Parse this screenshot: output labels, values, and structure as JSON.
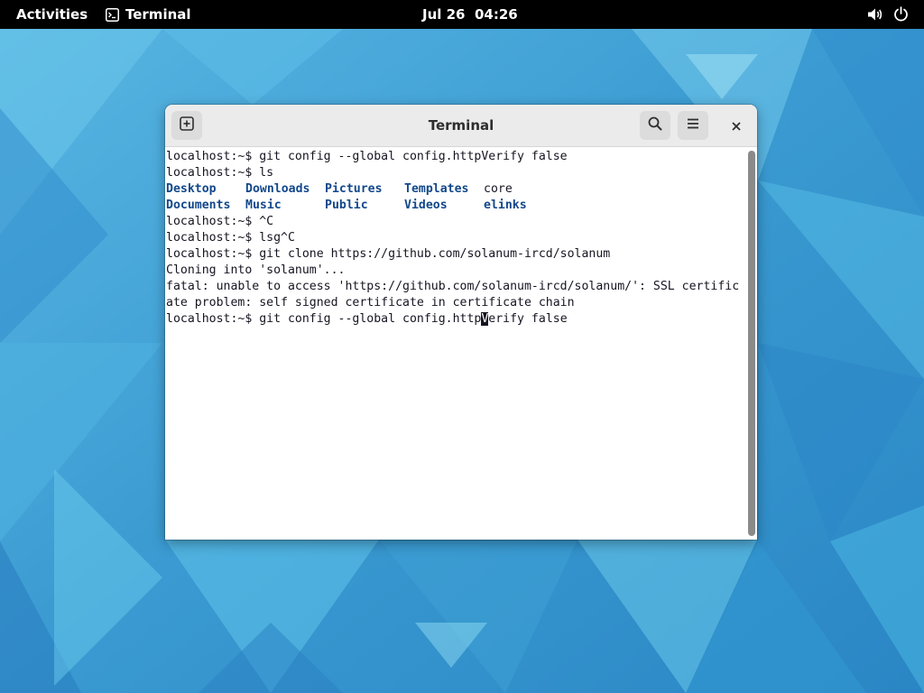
{
  "topbar": {
    "activities_label": "Activities",
    "app_name": "Terminal",
    "app_icon": "terminal-icon",
    "clock": "Jul 26  04:26",
    "status_icons": [
      "volume-icon",
      "power-icon"
    ]
  },
  "window": {
    "title": "Terminal",
    "buttons": [
      "new-tab-icon",
      "search-icon",
      "hamburger-menu-icon",
      "close-icon"
    ]
  },
  "terminal": {
    "lines": [
      "localhost:~$ git config --global config.httpVerify false",
      "localhost:~$ ls"
    ],
    "ls_output": [
      [
        "Desktop",
        "Downloads",
        "Pictures",
        "Templates",
        "core"
      ],
      [
        "Documents",
        "Music",
        "Public",
        "Videos",
        "elinks"
      ]
    ],
    "lines_after": [
      "localhost:~$ ^C",
      "localhost:~$ lsg^C",
      "localhost:~$ git clone https://github.com/solanum-ircd/solanum",
      "Cloning into 'solanum'...",
      "fatal: unable to access 'https://github.com/solanum-ircd/solanum/': SSL certific",
      "ate problem: self signed certificate in certificate chain"
    ],
    "current_command_before_cursor": "localhost:~$ git config --global config.http",
    "cursor_char": "V",
    "current_command_after_cursor": "erify false"
  },
  "colors": {
    "topbar_bg": "#000000",
    "directory_text": "#12488b",
    "terminal_text": "#171421",
    "headerbar_bg": "#ebebeb",
    "desktop_bg": "#3f9fd2"
  }
}
